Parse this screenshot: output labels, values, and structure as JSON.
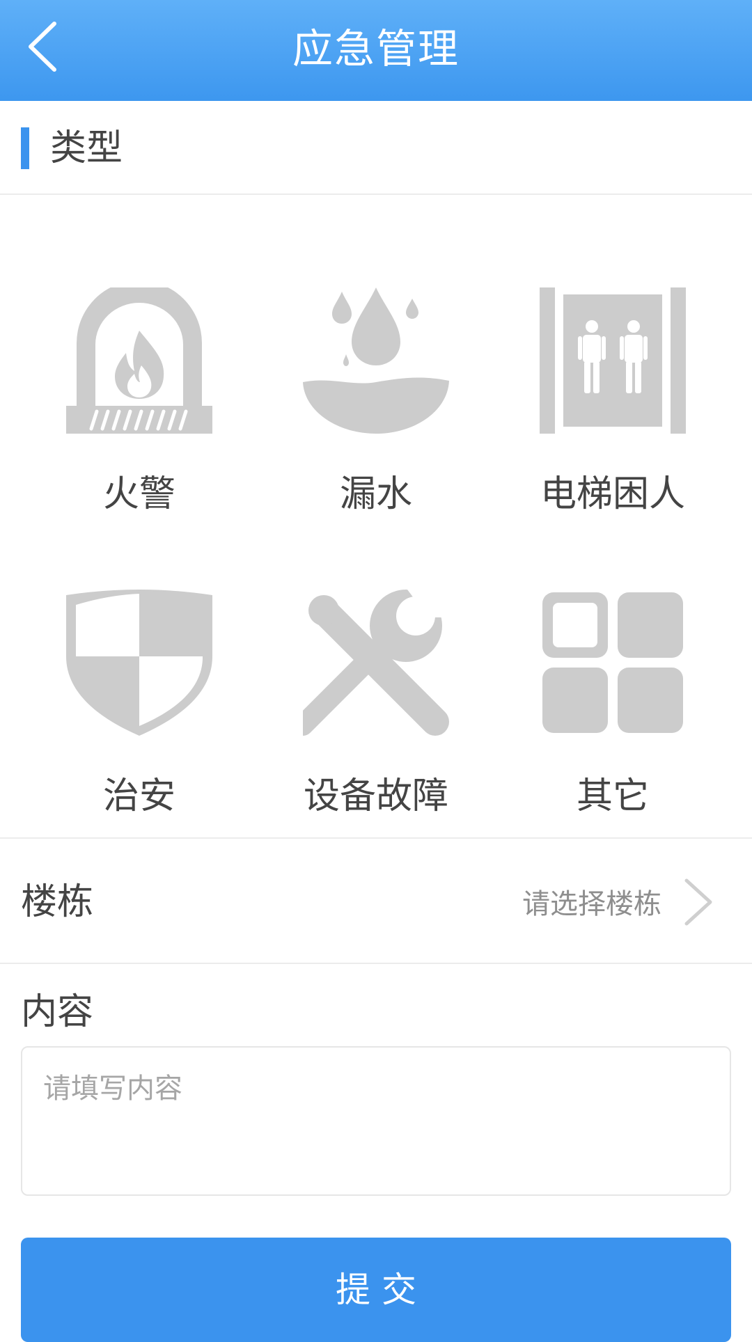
{
  "header": {
    "title": "应急管理",
    "back_icon": "chevron-left-icon"
  },
  "type_section": {
    "title": "类型",
    "items": [
      {
        "label": "火警",
        "icon": "fireplace-icon"
      },
      {
        "label": "漏水",
        "icon": "water-leak-icon"
      },
      {
        "label": "电梯困人",
        "icon": "elevator-icon"
      },
      {
        "label": "治安",
        "icon": "shield-icon"
      },
      {
        "label": "设备故障",
        "icon": "tools-icon"
      },
      {
        "label": "其它",
        "icon": "grid-icon"
      }
    ]
  },
  "building": {
    "label": "楼栋",
    "placeholder": "请选择楼栋"
  },
  "content": {
    "label": "内容",
    "placeholder": "请填写内容"
  },
  "submit": {
    "label": "提交"
  },
  "colors": {
    "primary": "#3b93ee",
    "header_top": "#5fb0f8",
    "icon_gray": "#cccccc",
    "text": "#444444",
    "placeholder": "#a6a6a6"
  }
}
